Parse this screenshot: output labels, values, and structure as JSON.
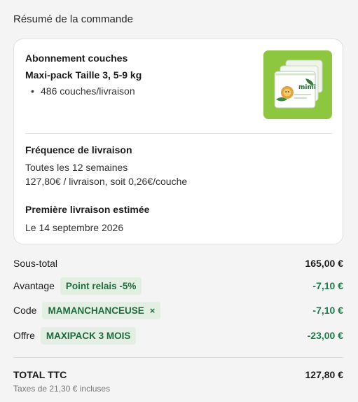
{
  "summary": {
    "title": "Résumé de la commande"
  },
  "product": {
    "name_line1": "Abonnement couches",
    "name_line2": "Maxi-pack Taille 3, 5-9 kg",
    "bullets": [
      "486 couches/livraison"
    ],
    "image_icon": "diaper-pack-image",
    "image_brand_text": "mimi",
    "image_bg": "#8dc63f"
  },
  "frequency": {
    "title": "Fréquence de livraison",
    "line1": "Toutes les 12 semaines",
    "line2": "127,80€ / livraison, soit 0,26€/couche"
  },
  "first_delivery": {
    "title": "Première livraison estimée",
    "date": "Le 14 septembre 2026"
  },
  "lines": {
    "subtotal": {
      "label": "Sous-total",
      "amount": "165,00 €"
    },
    "advantage": {
      "label": "Avantage",
      "chip": "Point relais -5%",
      "amount": "-7,10 €"
    },
    "code": {
      "label": "Code",
      "chip": "MAMANCHANCEUSE",
      "chip_close": "×",
      "amount": "-7,10 €"
    },
    "offer": {
      "label": "Offre",
      "chip": "MAXIPACK 3 MOIS",
      "amount": "-23,00 €"
    }
  },
  "total": {
    "label": "TOTAL TTC",
    "amount": "127,80 €",
    "tax_note": "Taxes de 21,30 € incluses"
  },
  "colors": {
    "accent_green": "#1e7a4a",
    "chip_bg": "#e3efe3",
    "product_bg": "#8dc63f"
  }
}
